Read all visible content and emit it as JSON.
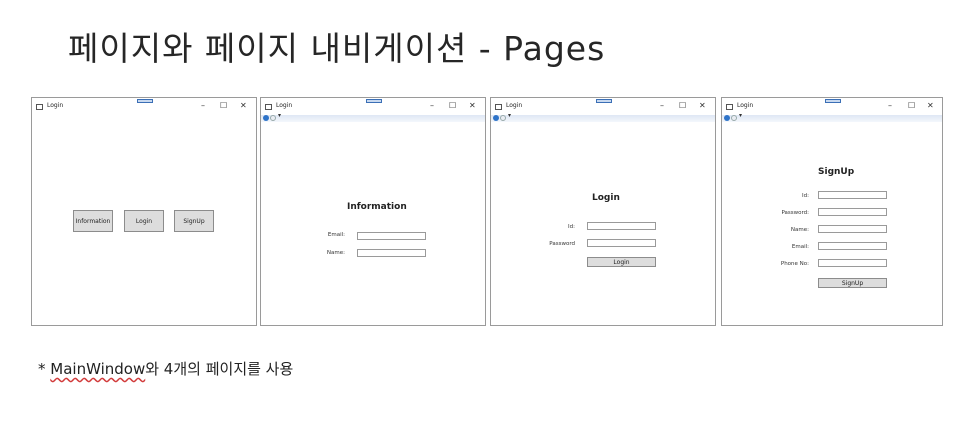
{
  "page": {
    "title": "페이지와 페이지 내비게이션 - Pages",
    "note_prefix": "* ",
    "note_link": "MainWindow",
    "note_suffix": "와 4개의 페이지를 사용"
  },
  "window_title": "Login",
  "caption": {
    "minimize": "–",
    "maximize": "☐",
    "close": "✕"
  },
  "nav_dropdown": "▾",
  "windows": {
    "main": {
      "buttons": [
        "Information",
        "Login",
        "SignUp"
      ]
    },
    "information": {
      "heading": "Information",
      "email_label": "Email:",
      "name_label": "Name:"
    },
    "login": {
      "heading": "Login",
      "id_label": "Id:",
      "password_label": "Password",
      "button": "Login"
    },
    "signup": {
      "heading": "SignUp",
      "id_label": "Id:",
      "password_label": "Password:",
      "name_label": "Name:",
      "email_label": "Email:",
      "phone_label": "Phone No:",
      "button": "SignUp"
    }
  }
}
